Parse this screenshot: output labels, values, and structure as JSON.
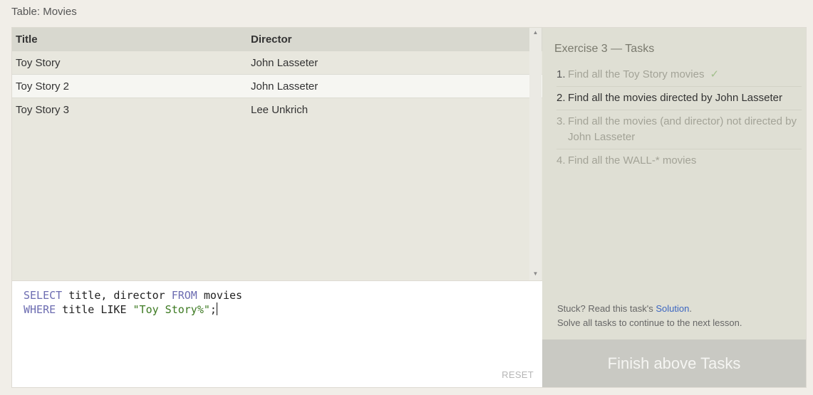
{
  "table_label": "Table: Movies",
  "table": {
    "columns": [
      "Title",
      "Director"
    ],
    "rows": [
      {
        "title": "Toy Story",
        "director": "John Lasseter"
      },
      {
        "title": "Toy Story 2",
        "director": "John Lasseter"
      },
      {
        "title": "Toy Story 3",
        "director": "Lee Unkrich"
      }
    ],
    "highlighted_row": 1
  },
  "scrollbar": {
    "up_icon": "▲",
    "down_icon": "▼"
  },
  "editor": {
    "line1": {
      "kw1": "SELECT",
      "t1": " title, director ",
      "kw2": "FROM",
      "t2": " movies"
    },
    "line2": {
      "kw1": "WHERE",
      "t1": " title LIKE ",
      "str": "\"Toy Story%\"",
      "t2": ";"
    },
    "reset_label": "RESET"
  },
  "exercise": {
    "title": "Exercise 3 — Tasks",
    "tasks": [
      {
        "num": "1.",
        "text": "Find all the Toy Story movies",
        "status": "done",
        "check": "✓"
      },
      {
        "num": "2.",
        "text": "Find all the movies directed by John Lasseter",
        "status": "current"
      },
      {
        "num": "3.",
        "text": "Find all the movies (and director) not directed by John Lasseter",
        "status": "todo"
      },
      {
        "num": "4.",
        "text": "Find all the WALL-* movies",
        "status": "todo"
      }
    ],
    "help_prefix": "Stuck? Read this task's ",
    "help_link": "Solution",
    "help_suffix": ".",
    "help_line2": "Solve all tasks to continue to the next lesson.",
    "finish_label": "Finish above Tasks"
  },
  "colors": {
    "keyword": "#6c6cb1",
    "string": "#3d7a22",
    "link": "#3c66c0",
    "check": "#a3c08d"
  }
}
